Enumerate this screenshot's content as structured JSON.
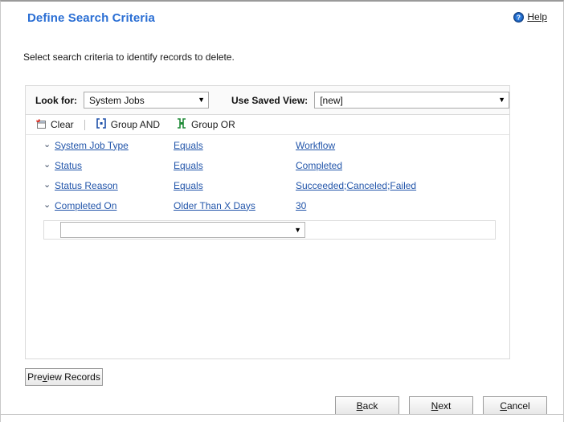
{
  "header": {
    "title": "Define Search Criteria",
    "help_label": "Help",
    "help_icon": "help-circle-icon"
  },
  "subtitle": "Select search criteria to identify records to delete.",
  "lookfor_bar": {
    "lookfor_label": "Look for:",
    "lookfor_value": "System Jobs",
    "savedview_label": "Use Saved View:",
    "savedview_value": "[new]",
    "caret": "▼"
  },
  "toolbar": {
    "clear_label": "Clear",
    "clear_icon": "clear-window-icon",
    "group_and_label": "Group AND",
    "group_and_icon": "group-and-bracket-icon",
    "group_or_label": "Group OR",
    "group_or_icon": "group-or-bracket-icon"
  },
  "criteria": {
    "chevron": "⌄",
    "rows": [
      {
        "field": "System Job Type",
        "operator": "Equals",
        "value": "Workflow"
      },
      {
        "field": "Status",
        "operator": "Equals",
        "value": "Completed"
      },
      {
        "field": "Status Reason",
        "operator": "Equals",
        "value": "Succeeded;Canceled;Failed"
      },
      {
        "field": "Completed On",
        "operator": "Older Than X Days",
        "value": "30"
      }
    ],
    "new_row": {
      "value": "",
      "caret": "▼"
    }
  },
  "buttons": {
    "preview_records": {
      "pre": "Pre",
      "accel": "v",
      "post": "iew Records"
    },
    "back": {
      "accel": "B",
      "post": "ack"
    },
    "next": {
      "accel": "N",
      "post": "ext"
    },
    "cancel": {
      "accel": "C",
      "post": "ancel"
    }
  },
  "colors": {
    "title_blue": "#2b6fd4",
    "link_blue": "#2255aa",
    "panel_border": "#dadada",
    "bar_bg": "#fafafa"
  }
}
